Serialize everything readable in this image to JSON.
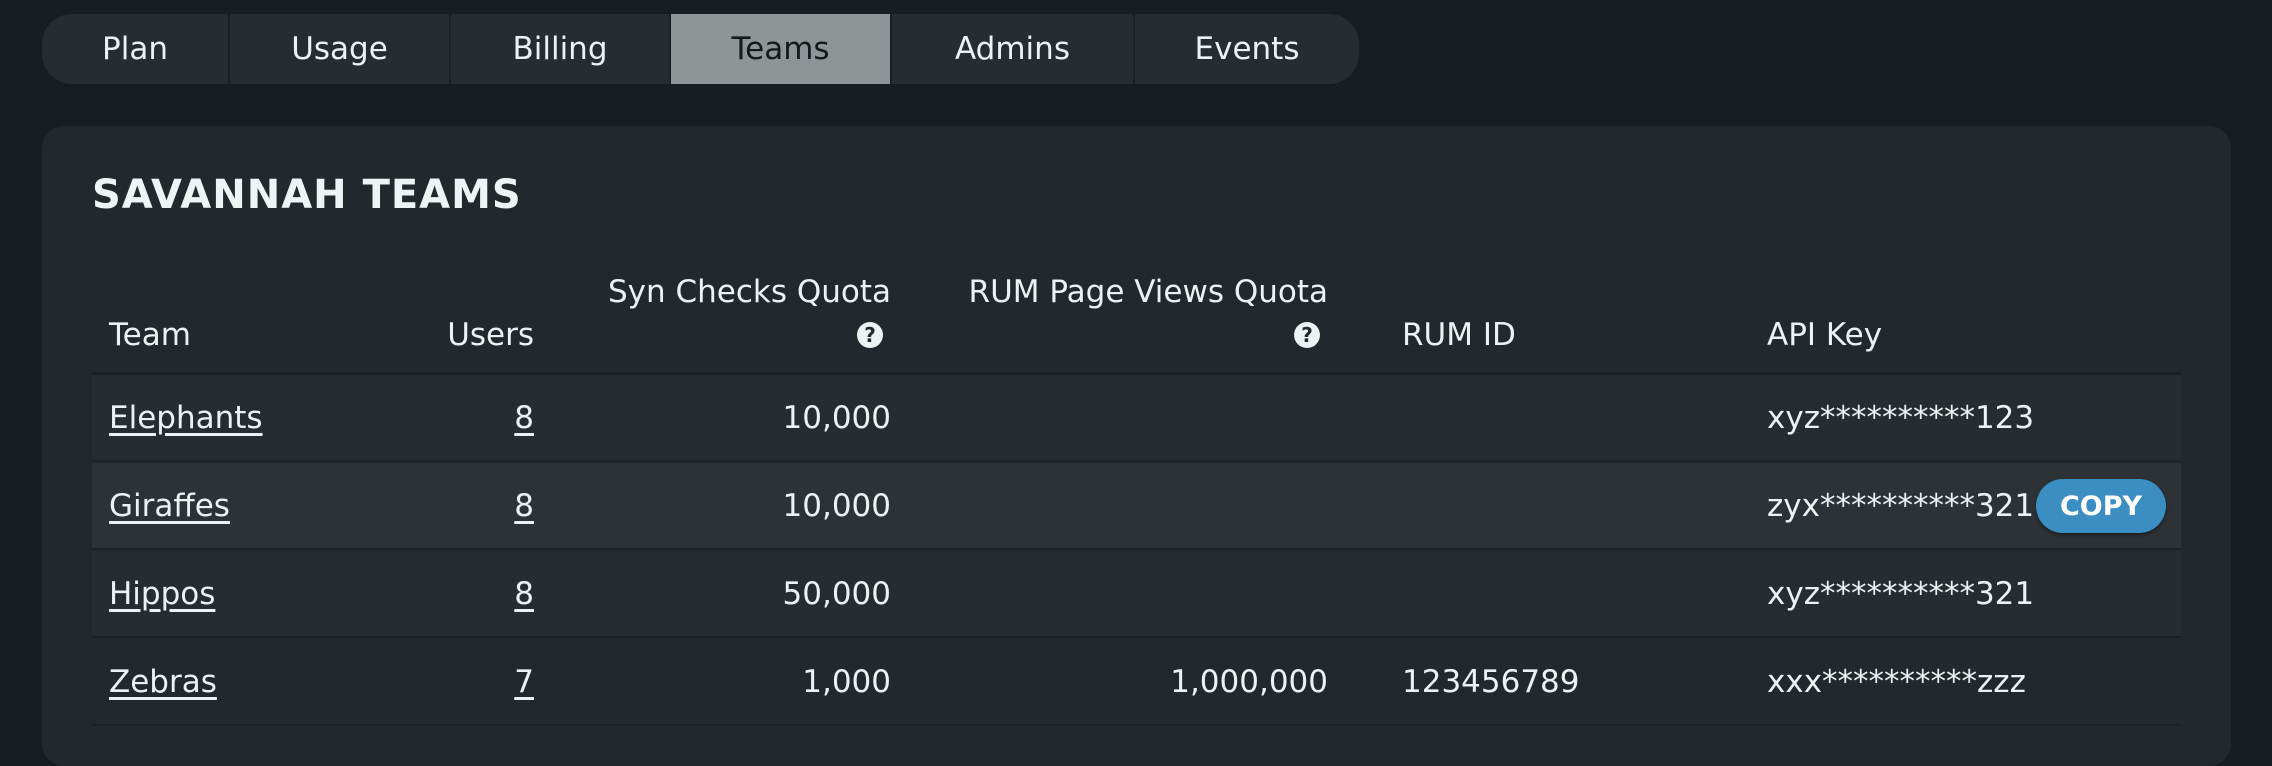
{
  "tabs": [
    {
      "label": "Plan"
    },
    {
      "label": "Usage"
    },
    {
      "label": "Billing"
    },
    {
      "label": "Teams"
    },
    {
      "label": "Admins"
    },
    {
      "label": "Events"
    }
  ],
  "active_tab": "Teams",
  "panel": {
    "title": "SAVANNAH TEAMS"
  },
  "table": {
    "headers": {
      "team": "Team",
      "users": "Users",
      "syn_checks_quota": "Syn Checks Quota",
      "rum_page_views_quota": "RUM Page Views Quota",
      "rum_id": "RUM ID",
      "api_key": "API Key"
    },
    "help_icon": "?",
    "copy_label": "COPY",
    "rows": [
      {
        "team": "Elephants",
        "users": "8",
        "syn": "10,000",
        "rum_quota": "",
        "rum_id": "",
        "api_key": "xyz**********123"
      },
      {
        "team": "Giraffes",
        "users": "8",
        "syn": "10,000",
        "rum_quota": "",
        "rum_id": "",
        "api_key": "zyx**********321"
      },
      {
        "team": "Hippos",
        "users": "8",
        "syn": "50,000",
        "rum_quota": "",
        "rum_id": "",
        "api_key": "xyz**********321"
      },
      {
        "team": "Zebras",
        "users": "7",
        "syn": "1,000",
        "rum_quota": "1,000,000",
        "rum_id": "123456789",
        "api_key": "xxx**********zzz"
      }
    ]
  },
  "colors": {
    "background": "#171d20",
    "panel": "#22282b",
    "active_tab": "#8f9496",
    "copy_button": "#3b8ec2"
  }
}
